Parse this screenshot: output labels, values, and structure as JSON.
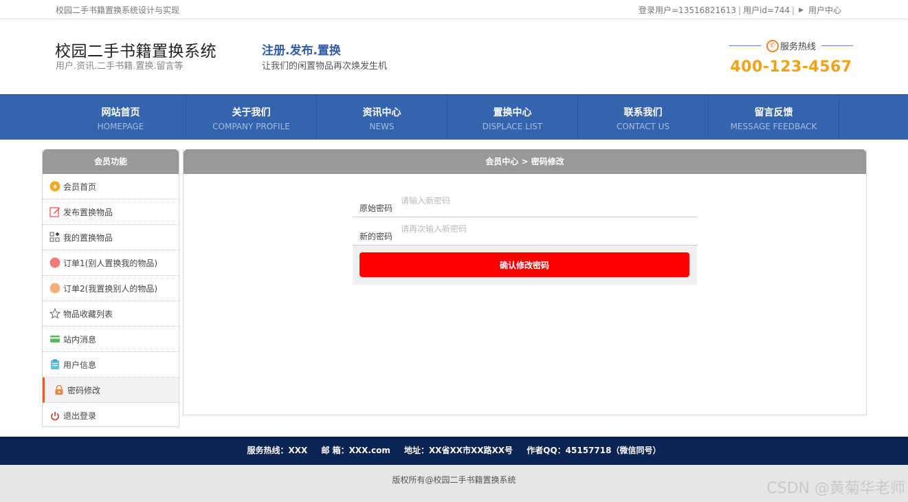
{
  "topbar": {
    "left_text": "校园二手书籍置换系统设计与实现",
    "user_login": "登录用户=13516821613",
    "user_id": "用户id=744",
    "user_center": "用户中心"
  },
  "header": {
    "title": "校园二手书籍置换系统",
    "subtitle": "用户.资讯.二手书籍.置换.留言等",
    "slogan": "注册.发布.置换",
    "slogan_sub": "让我们的闲置物品再次焕发生机",
    "hotline_label": "服务热线",
    "hotline_number": "400-123-4567"
  },
  "nav": {
    "items": [
      {
        "cn": "网站首页",
        "en": "HOMEPAGE"
      },
      {
        "cn": "关于我们",
        "en": "COMPANY PROFILE"
      },
      {
        "cn": "资讯中心",
        "en": "NEWS"
      },
      {
        "cn": "置换中心",
        "en": "DISPLACE LIST"
      },
      {
        "cn": "联系我们",
        "en": "CONTACT US"
      },
      {
        "cn": "留言反馈",
        "en": "MESSAGE FEEDBACK"
      }
    ]
  },
  "sidebar": {
    "title": "会员功能",
    "items": [
      {
        "label": "会员首页",
        "icon": "home-icon",
        "color": "#f5a623"
      },
      {
        "label": "发布置换物品",
        "icon": "edit-icon",
        "color": "#e94b4b"
      },
      {
        "label": "我的置换物品",
        "icon": "grid-icon",
        "color": "#666666"
      },
      {
        "label": "订单1(别人置换我的物品)",
        "icon": "order-icon",
        "color": "#f07b7b"
      },
      {
        "label": "订单2(我置换别人的物品)",
        "icon": "order2-icon",
        "color": "#f5b07b"
      },
      {
        "label": "物品收藏列表",
        "icon": "star-icon",
        "color": "#666666"
      },
      {
        "label": "站内消息",
        "icon": "message-icon",
        "color": "#5cb85c"
      },
      {
        "label": "用户信息",
        "icon": "user-info-icon",
        "color": "#5bc0de"
      },
      {
        "label": "密码修改",
        "icon": "lock-icon",
        "color": "#e8874a"
      },
      {
        "label": "退出登录",
        "icon": "power-icon",
        "color": "#c9302c"
      }
    ],
    "active_index": 8
  },
  "content": {
    "breadcrumb": "会员中心 > 密码修改",
    "form": {
      "old_password_label": "原始密码",
      "old_password_placeholder": "请输入新密码",
      "new_password_label": "新的密码",
      "new_password_placeholder": "请再次输入新密码",
      "submit_label": "确认修改密码"
    }
  },
  "footer": {
    "hotline": "服务热线：XXX",
    "email": "邮 箱：XXX.com",
    "address": "地址：XX省XX市XX路XX号",
    "qq": "作者QQ：45157718（微信同号）",
    "copyright": "版权所有@校园二手书籍置换系统"
  },
  "watermark": "CSDN @黄菊华老师"
}
